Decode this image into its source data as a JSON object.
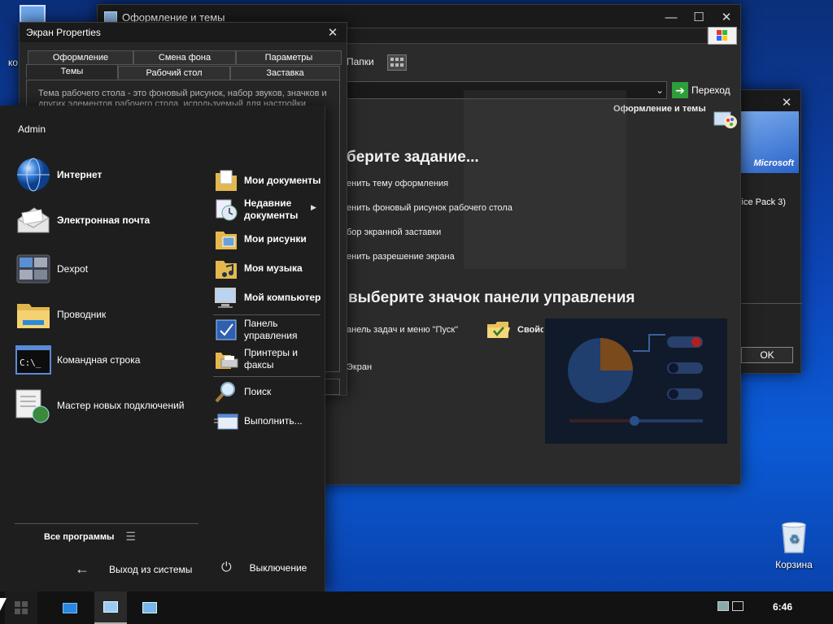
{
  "desktop": {
    "recycle_bin_label": "Корзина",
    "partial_icon_label": "ко"
  },
  "control_panel": {
    "title": "Оформление и темы",
    "toolbar_folders": "Папки",
    "go_button": "Переход",
    "category_title": "Оформление и темы",
    "pick_task": "берите задание...",
    "tasks": [
      "енить тему оформления",
      "енить фоновый рисунок рабочего стола",
      "бор экранной заставки",
      "енить разрешение экрана"
    ],
    "pick_icon": "выберите значок панели управления",
    "icons": [
      "анель задач и меню \"Пуск\"",
      "Свойства папки",
      "Экран"
    ]
  },
  "properties": {
    "title": "Экран Properties",
    "tabs_row1": [
      "Оформление",
      "Смена фона",
      "Параметры"
    ],
    "tabs_row2": [
      "Темы",
      "Рабочий стол",
      "Заставка"
    ],
    "description": "Тема рабочего стола - это фоновый рисунок, набор звуков, значков и других элементов рабочего стола, используемый для настройки"
  },
  "about": {
    "brand": "Microsoft",
    "version_text": "vice Pack 3)",
    "ok_button": "OK"
  },
  "start_menu": {
    "user": "Admin",
    "left_items": [
      {
        "label": "Интернет",
        "bold": true,
        "icon": "globe-icon"
      },
      {
        "label": "Электронная почта",
        "bold": true,
        "icon": "mail-icon"
      },
      {
        "label": "Dexpot",
        "bold": false,
        "icon": "dexpot-icon"
      },
      {
        "label": "Проводник",
        "bold": false,
        "icon": "folder-explorer-icon"
      },
      {
        "label": "Командная строка",
        "bold": false,
        "icon": "cmd-icon"
      },
      {
        "label": "Мастер новых подключений",
        "bold": false,
        "icon": "network-wizard-icon"
      }
    ],
    "all_programs": "Все программы",
    "right_items": [
      {
        "label": "Мои документы",
        "bold": true
      },
      {
        "label": "Недавние документы",
        "bold": true
      },
      {
        "label": "Мои рисунки",
        "bold": true
      },
      {
        "label": "Моя музыка",
        "bold": true
      },
      {
        "label": "Мой компьютер",
        "bold": true
      },
      {
        "label": "Панель управления",
        "bold": false
      },
      {
        "label": "Принтеры и факсы",
        "bold": false
      },
      {
        "label": "Поиск",
        "bold": false
      },
      {
        "label": "Выполнить...",
        "bold": false
      }
    ],
    "logoff": "Выход из системы",
    "shutdown": "Выключение"
  },
  "taskbar": {
    "clock": "6:46"
  },
  "colors": {
    "accent_green": "#2e9e3a",
    "start_menu_bg": "#1e1e1e",
    "taskbar_bg": "#121212"
  }
}
